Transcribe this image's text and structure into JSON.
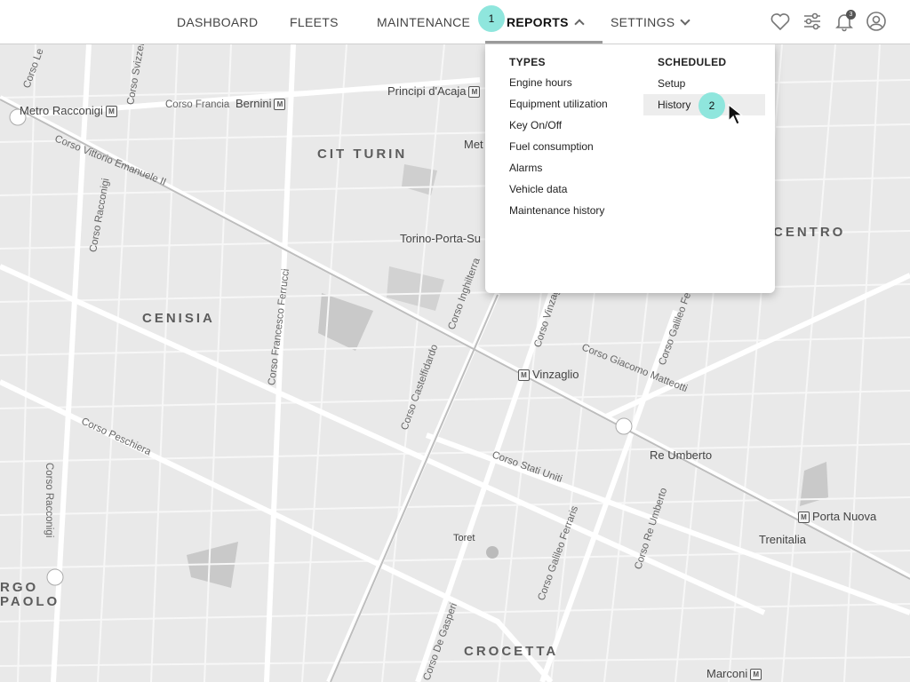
{
  "nav": {
    "items": [
      {
        "label": "DASHBOARD"
      },
      {
        "label": "FLEETS"
      },
      {
        "label": "MAINTENANCE"
      },
      {
        "label": "REPORTS"
      },
      {
        "label": "SETTINGS"
      }
    ],
    "notification_count": "3"
  },
  "icons": {
    "favorites": "heart-icon",
    "filters": "sliders-icon",
    "notifications": "bell-icon",
    "account": "user-icon"
  },
  "dropdown": {
    "types_heading": "TYPES",
    "types": [
      "Engine hours",
      "Equipment utilization",
      "Key On/Off",
      "Fuel consumption",
      "Alarms",
      "Vehicle data",
      "Maintenance history"
    ],
    "scheduled_heading": "SCHEDULED",
    "scheduled": [
      "Setup",
      "History"
    ]
  },
  "callouts": [
    "1",
    "2"
  ],
  "map": {
    "districts": [
      "CIT TURIN",
      "CENISIA",
      "CROCETTA",
      "CENTRO",
      "RGO",
      "PAOLO"
    ],
    "places": [
      "Metro Racconigi",
      "Bernini",
      "Principi d'Acaja",
      "Torino-Porta-Su",
      "Vinzaglio",
      "Re Umberto",
      "Porta Nuova",
      "Trenitalia",
      "Marconi",
      "Toret",
      "Met"
    ],
    "streets": [
      "Corso Vittorio Emanuele II",
      "Corso Francia",
      "Corso Racconigi",
      "Corso Francesco Ferrucci",
      "Corso Castelfidardo",
      "Corso Inghilterra",
      "Corso Vinzaglio",
      "Corso Galileo Ferraris",
      "Corso Re Umberto",
      "Corso Stati Uniti",
      "Corso Giacomo Matteotti",
      "Corso Peschiera",
      "Corso Svizzera",
      "Corso Le",
      "Corso Galileo Fe",
      "Corso De Gasperi"
    ]
  },
  "colors": {
    "callout": "#8fe6dd",
    "map_bg": "#e9e9e9",
    "road": "#ffffff"
  }
}
